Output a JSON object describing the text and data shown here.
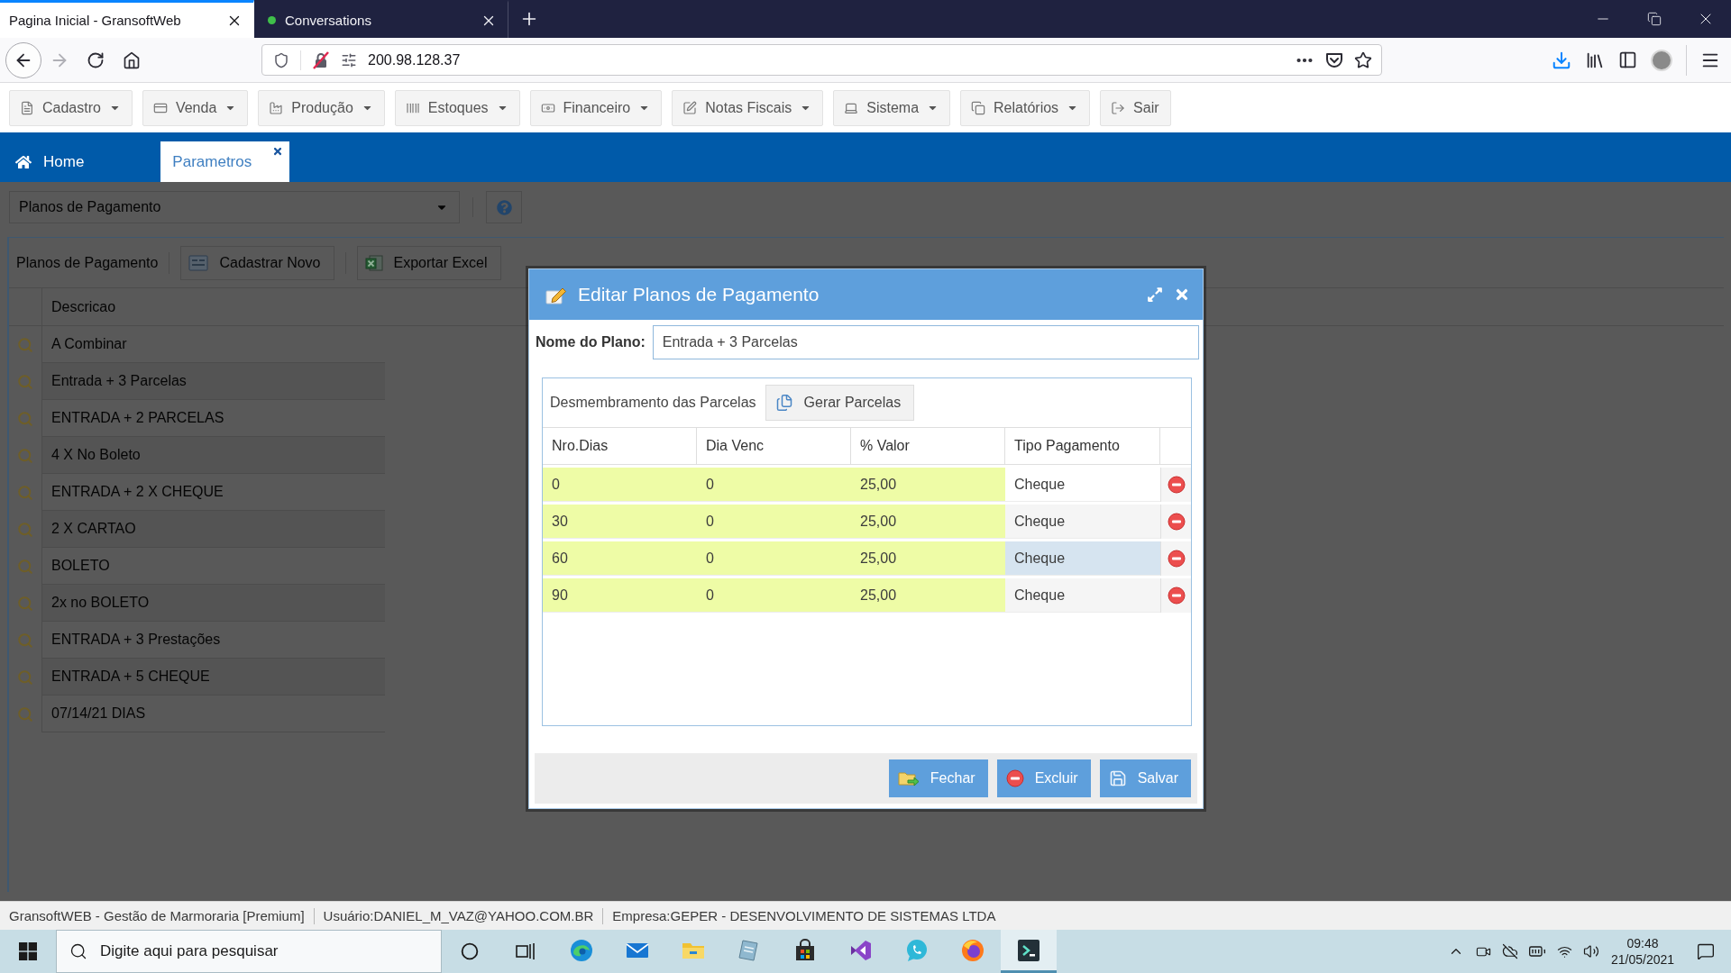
{
  "browser": {
    "tabs": [
      {
        "title": "Pagina Inicial - GransoftWeb",
        "selected": true,
        "indicator": false
      },
      {
        "title": "Conversations",
        "selected": false,
        "indicator": true
      }
    ],
    "url": "200.98.128.37"
  },
  "menu": [
    {
      "label": "Cadastro",
      "dropdown": true
    },
    {
      "label": "Venda",
      "dropdown": true
    },
    {
      "label": "Produção",
      "dropdown": true
    },
    {
      "label": "Estoques",
      "dropdown": true
    },
    {
      "label": "Financeiro",
      "dropdown": true
    },
    {
      "label": "Notas Fiscais",
      "dropdown": true
    },
    {
      "label": "Sistema",
      "dropdown": true
    },
    {
      "label": "Relatórios",
      "dropdown": true
    },
    {
      "label": "Sair",
      "dropdown": false
    }
  ],
  "app_tabs": [
    {
      "label": "Home",
      "kind": "home",
      "selected": false
    },
    {
      "label": "Parametros",
      "kind": "closable",
      "selected": true
    }
  ],
  "selector": {
    "value": "Planos de Pagamento"
  },
  "list_panel": {
    "title": "Planos de Pagamento",
    "buttons": [
      "Cadastrar Novo",
      "Exportar Excel"
    ],
    "column": "Descricao",
    "rows": [
      "A Combinar",
      "Entrada + 3 Parcelas",
      "ENTRADA + 2 PARCELAS",
      "4 X No Boleto",
      "ENTRADA + 2 X CHEQUE",
      "2 X CARTAO",
      "BOLETO",
      "2x no BOLETO",
      "ENTRADA + 3 Prestações",
      "ENTRADA + 5 CHEQUE",
      "07/14/21 DIAS"
    ]
  },
  "dialog": {
    "title": "Editar Planos de Pagamento",
    "name_label": "Nome do Plano:",
    "name_value": "Entrada + 3 Parcelas",
    "section_label": "Desmembramento das Parcelas",
    "generate_button": "Gerar Parcelas",
    "columns": [
      {
        "label": "Nro.Dias",
        "editable": true
      },
      {
        "label": "Dia Venc",
        "editable": true
      },
      {
        "label": "% Valor",
        "editable": true
      },
      {
        "label": "Tipo Pagamento",
        "editable": false
      }
    ],
    "rows": [
      {
        "cells": [
          "0",
          "0",
          "25,00",
          "Cheque"
        ],
        "hovered": false
      },
      {
        "cells": [
          "30",
          "0",
          "25,00",
          "Cheque"
        ],
        "hovered": false
      },
      {
        "cells": [
          "60",
          "0",
          "25,00",
          "Cheque"
        ],
        "hovered": true
      },
      {
        "cells": [
          "90",
          "0",
          "25,00",
          "Cheque"
        ],
        "hovered": false
      }
    ],
    "buttons": [
      {
        "label": "Fechar",
        "kind": "close"
      },
      {
        "label": "Excluir",
        "kind": "delete"
      },
      {
        "label": "Salvar",
        "kind": "save"
      }
    ]
  },
  "status_bar": [
    "GransoftWEB - Gestão de Marmoraria [Premium]",
    "Usuário:DANIEL_M_VAZ@YAHOO.COM.BR",
    "Empresa:GEPER - DESENVOLVIMENTO DE SISTEMAS LTDA"
  ],
  "taskbar": {
    "search": {
      "placeholder": "Digite aqui para pesquisar"
    },
    "apps": [
      {
        "active": false
      },
      {
        "active": false
      },
      {
        "active": false
      },
      {
        "active": false
      },
      {
        "active": false
      },
      {
        "active": false
      },
      {
        "active": false
      },
      {
        "active": false
      },
      {
        "active": true
      }
    ],
    "clock": {
      "time": "09:48",
      "date": "21/05/2021"
    }
  }
}
